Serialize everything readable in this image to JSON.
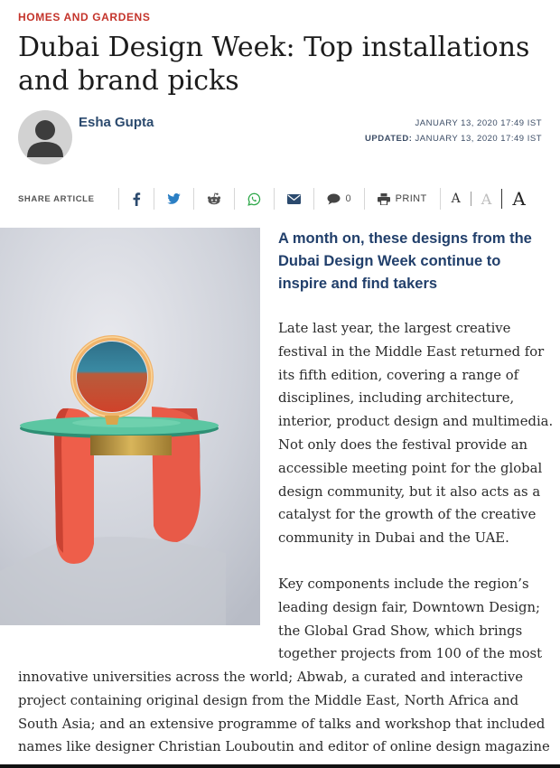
{
  "section": {
    "kicker": "HOMES AND GARDENS"
  },
  "article": {
    "headline": "Dubai Design Week: Top installations and brand picks",
    "author": "Esha Gupta",
    "published": "JANUARY 13, 2020 17:49 IST",
    "updated_label": "UPDATED:",
    "updated": "JANUARY 13, 2020 17:49 IST",
    "subhead": "A month on, these designs from the Dubai Design Week continue to inspire and find takers",
    "paragraph1": "Late last year, the largest creative festival in the Middle East returned for its fifth edition, covering a range of disciplines, including architecture, interior, product design and multimedia. Not only does the festival provide an accessible meeting point for the global design community, but it also acts as a catalyst for the growth of the creative community in Dubai and the UAE.",
    "paragraph2_part1": "Key components include the region’s leading design fair, Downtown Design; the Global Grad Show, which brings together projects from 100 of the most",
    "paragraph2_part2": "innovative universities across the world; Abwab, a curated and interactive project containing original design from the Middle East, North Africa and South Asia; and an extensive programme of talks and workshop that included names like designer Christian Louboutin and editor of online design magazine"
  },
  "share": {
    "label": "SHARE ARTICLE",
    "comments_count": "0",
    "print_label": "PRINT",
    "icons": [
      "facebook-icon",
      "twitter-icon",
      "reddit-icon",
      "whatsapp-icon",
      "email-icon",
      "comment-icon",
      "print-icon"
    ]
  },
  "font_size": {
    "small": "A",
    "medium": "A",
    "large": "A"
  },
  "colors": {
    "kicker": "#c4342b",
    "author": "#2b4a6e",
    "subhead": "#213f6b",
    "icon": "#2b4a6e",
    "whatsapp": "#2ea84a"
  }
}
